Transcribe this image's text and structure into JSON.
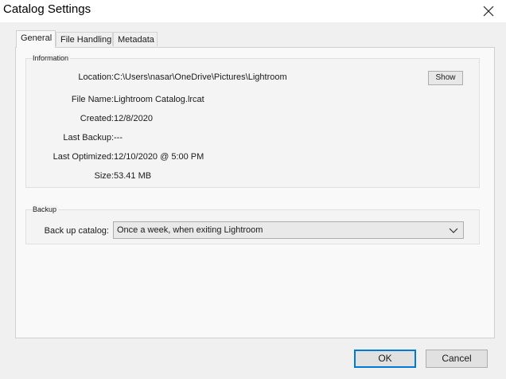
{
  "window": {
    "title": "Catalog Settings",
    "close_icon": "close-icon"
  },
  "tabs": [
    {
      "label": "General",
      "active": true
    },
    {
      "label": "File Handling",
      "active": false
    },
    {
      "label": "Metadata",
      "active": false
    }
  ],
  "information": {
    "title": "Information",
    "rows": [
      {
        "label": "Location:",
        "value": "C:\\Users\\nasar\\OneDrive\\Pictures\\Lightroom"
      },
      {
        "label": "File Name:",
        "value": "Lightroom Catalog.lrcat"
      },
      {
        "label": "Created:",
        "value": "12/8/2020"
      },
      {
        "label": "Last Backup:",
        "value": "---"
      },
      {
        "label": "Last Optimized:",
        "value": "12/10/2020 @ 5:00 PM"
      },
      {
        "label": "Size:",
        "value": "53.41 MB"
      }
    ],
    "show_button": "Show"
  },
  "backup": {
    "title": "Backup",
    "label": "Back up catalog:",
    "selected": "Once a week, when exiting Lightroom",
    "chevron_icon": "chevron-down-icon"
  },
  "footer": {
    "ok_label": "OK",
    "cancel_label": "Cancel"
  },
  "colors": {
    "accent": "#0078d7",
    "background": "#f0f0f0"
  }
}
